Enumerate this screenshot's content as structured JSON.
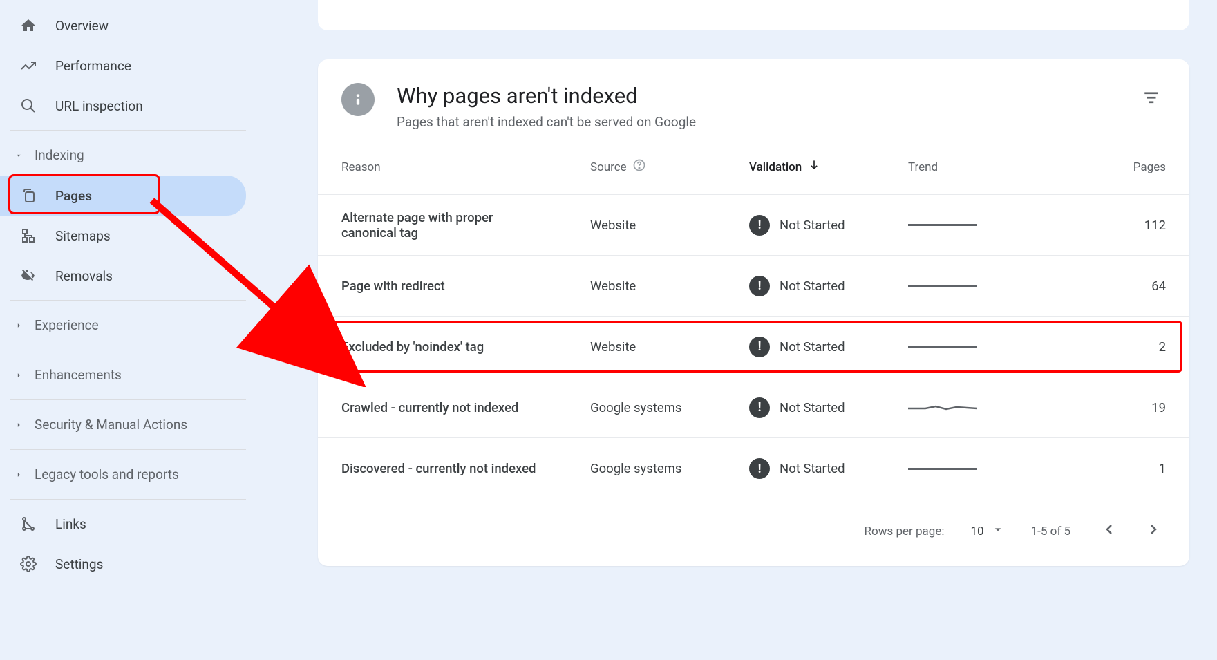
{
  "sidebar": {
    "overview": "Overview",
    "performance": "Performance",
    "url_inspection": "URL inspection",
    "indexing_header": "Indexing",
    "pages": "Pages",
    "sitemaps": "Sitemaps",
    "removals": "Removals",
    "experience": "Experience",
    "enhancements": "Enhancements",
    "security": "Security & Manual Actions",
    "legacy": "Legacy tools and reports",
    "links": "Links",
    "settings": "Settings"
  },
  "card": {
    "title": "Why pages aren't indexed",
    "subtitle": "Pages that aren't indexed can't be served on Google"
  },
  "table": {
    "headers": {
      "reason": "Reason",
      "source": "Source",
      "validation": "Validation",
      "trend": "Trend",
      "pages": "Pages"
    },
    "rows": [
      {
        "reason": "Alternate page with proper canonical tag",
        "source": "Website",
        "validation": "Not Started",
        "trend": "flat",
        "pages": "112"
      },
      {
        "reason": "Page with redirect",
        "source": "Website",
        "validation": "Not Started",
        "trend": "flat",
        "pages": "64"
      },
      {
        "reason": "Excluded by 'noindex' tag",
        "source": "Website",
        "validation": "Not Started",
        "trend": "flat",
        "pages": "2"
      },
      {
        "reason": "Crawled - currently not indexed",
        "source": "Google systems",
        "validation": "Not Started",
        "trend": "wavy",
        "pages": "19"
      },
      {
        "reason": "Discovered - currently not indexed",
        "source": "Google systems",
        "validation": "Not Started",
        "trend": "flat",
        "pages": "1"
      }
    ]
  },
  "footer": {
    "rows_per_page_label": "Rows per page:",
    "rows_per_page_value": "10",
    "range": "1-5 of 5"
  }
}
